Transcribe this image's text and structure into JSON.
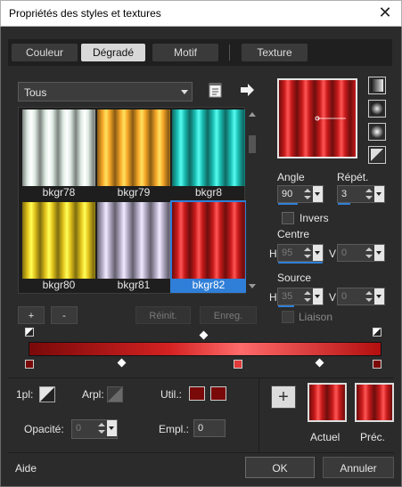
{
  "window": {
    "title": "Propriétés des styles et textures",
    "close_glyph": "✕"
  },
  "tabs": [
    {
      "label": "Couleur",
      "active": false
    },
    {
      "label": "Dégradé",
      "active": true
    },
    {
      "label": "Motif",
      "active": false
    },
    {
      "label": "Texture",
      "active": false
    }
  ],
  "gallery": {
    "category": "Tous",
    "items": [
      {
        "name": "bkgr78",
        "color": "#dfece4",
        "selected": false
      },
      {
        "name": "bkgr79",
        "color": "#f6a626",
        "selected": false
      },
      {
        "name": "bkgr8",
        "color": "#1bbfb4",
        "selected": false
      },
      {
        "name": "bkgr80",
        "color": "#e3c51c",
        "selected": false
      },
      {
        "name": "bkgr81",
        "color": "#b6aec8",
        "selected": false
      },
      {
        "name": "bkgr82",
        "color": "#c81a1a",
        "selected": true
      }
    ],
    "add_label": "+",
    "remove_label": "-",
    "reset_label": "Réinit.",
    "save_label": "Enreg."
  },
  "params": {
    "angle_label": "Angle",
    "angle_value": "90",
    "repeat_label": "Répét.",
    "repeat_value": "3",
    "invert_label": "Invers",
    "center_label": "Centre",
    "center_h_label": "H",
    "center_h_value": "95",
    "center_v_label": "V",
    "center_v_value": "0",
    "source_label": "Source",
    "source_h_label": "H",
    "source_h_value": "35",
    "source_v_label": "V",
    "source_v_value": "0",
    "link_label": "Liaison"
  },
  "editor": {
    "opl_label": "1pl:",
    "arpl_label": "Arpl:",
    "util_label": "Util.:",
    "opacity_label": "Opacité:",
    "opacity_value": "0",
    "empl_label": "Empl.:",
    "empl_value": "0",
    "accent_red": "#7a0909"
  },
  "swatches": {
    "add_glyph": "+",
    "current_label": "Actuel",
    "previous_label": "Préc."
  },
  "footer": {
    "help_label": "Aide",
    "ok_label": "OK",
    "cancel_label": "Annuler"
  }
}
